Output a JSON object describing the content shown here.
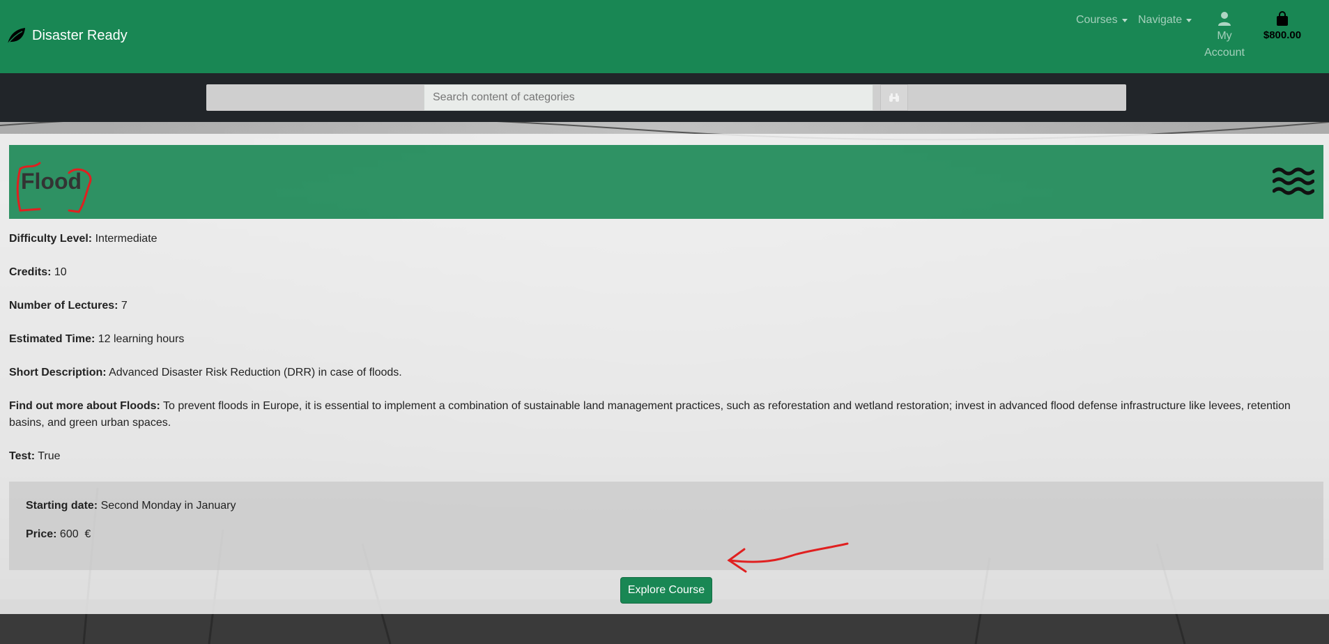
{
  "navbar": {
    "brand": "Disaster Ready",
    "courses_label": "Courses",
    "navigate_label": "Navigate",
    "account_line1": "My",
    "account_line2": "Account",
    "cart_total": "$800.00"
  },
  "search": {
    "placeholder": "Search content of categories",
    "value": ""
  },
  "course": {
    "title": "Flood",
    "difficulty_label": "Difficulty Level:",
    "difficulty_value": "Intermediate",
    "credits_label": "Credits:",
    "credits_value": "10",
    "lectures_label": "Number of Lectures:",
    "lectures_value": "7",
    "time_label": "Estimated Time:",
    "time_value": "12 learning hours",
    "short_desc_label": "Short Description:",
    "short_desc_value": "Advanced Disaster Risk Reduction (DRR) in case of floods.",
    "more_label": "Find out more about Floods:",
    "more_value": "To prevent floods in Europe, it is essential to implement a combination of sustainable land management practices, such as reforestation and wetland restoration; invest in advanced flood defense infrastructure like levees, retention basins, and green urban spaces.",
    "test_label": "Test:",
    "test_value": "True"
  },
  "enrollment": {
    "start_label": "Starting date:",
    "start_value": "Second Monday in January",
    "price_label": "Price:",
    "price_value": "600  €"
  },
  "actions": {
    "explore_label": "Explore Course"
  },
  "colors": {
    "primary_green": "#198754",
    "dark_bar": "#212529",
    "annotation_red": "#e02020"
  },
  "icons": {
    "brand": "leaf-icon",
    "account": "person-icon",
    "cart": "shopping-bag-icon",
    "search": "binoculars-icon",
    "category": "water-waves-icon"
  }
}
